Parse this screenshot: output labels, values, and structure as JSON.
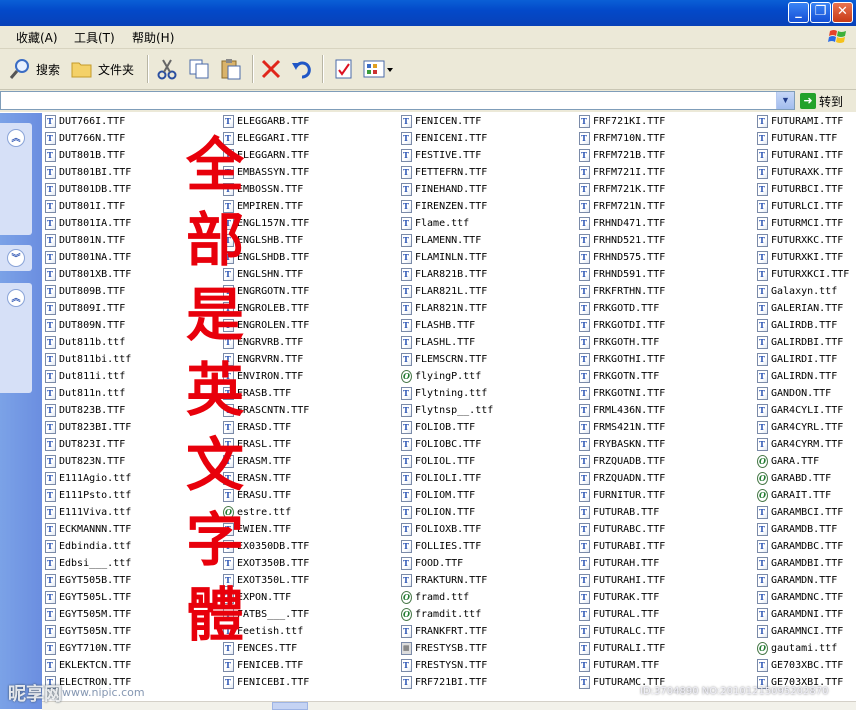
{
  "window": {
    "controls": {
      "minimize": "_",
      "restore": "❐",
      "close": "✕"
    }
  },
  "menubar": {
    "items": [
      "收藏(A)",
      "工具(T)",
      "帮助(H)"
    ]
  },
  "toolbar": {
    "search_label": "搜索",
    "folders_label": "文件夹"
  },
  "addressbar": {
    "value": "",
    "go_label": "转到"
  },
  "overlay_text": {
    "chars": [
      "全",
      "部",
      "是",
      "英",
      "文",
      "字",
      "體"
    ]
  },
  "files": {
    "columns": [
      [
        "DUT766I.TTF",
        "DUT766N.TTF",
        "DUT801B.TTF",
        "DUT801BI.TTF",
        "DUT801DB.TTF",
        "DUT801I.TTF",
        "DUT801IA.TTF",
        "DUT801N.TTF",
        "DUT801NA.TTF",
        "DUT801XB.TTF",
        "DUT809B.TTF",
        "DUT809I.TTF",
        "DUT809N.TTF",
        "Dut811b.ttf",
        "Dut811bi.ttf",
        "Dut811i.ttf",
        "Dut811n.ttf",
        "DUT823B.TTF",
        "DUT823BI.TTF",
        "DUT823I.TTF",
        "DUT823N.TTF",
        "E111Agio.ttf",
        "E111Psto.ttf",
        "E111Viva.ttf",
        "ECKMANNN.TTF",
        "Edbindia.ttf",
        "Edbsi___.ttf",
        "EGYT505B.TTF",
        "EGYT505L.TTF",
        "EGYT505M.TTF",
        "EGYT505N.TTF",
        "EGYT710N.TTF",
        "EKLEKTCN.TTF",
        "ELECTRON.TTF"
      ],
      [
        "ELEGGARB.TTF",
        "ELEGGARI.TTF",
        "ELEGGARN.TTF",
        "EMBASSYN.TTF",
        "EMBOSSN.TTF",
        "EMPIREN.TTF",
        "ENGL157N.TTF",
        "ENGLSHB.TTF",
        "ENGLSHDB.TTF",
        "ENGLSHN.TTF",
        "ENGRGOTN.TTF",
        "ENGROLEB.TTF",
        "ENGROLEN.TTF",
        "ENGRVRB.TTF",
        "ENGRVRN.TTF",
        "ENVIRON.TTF",
        "ERASB.TTF",
        "ERASCNTN.TTF",
        "ERASD.TTF",
        "ERASL.TTF",
        "ERASM.TTF",
        "ERASN.TTF",
        "ERASU.TTF",
        "estre.ttf",
        "EWIEN.TTF",
        "EX0350DB.TTF",
        "EXOT350B.TTF",
        "EXOT350L.TTF",
        "EXPON.TTF",
        "FATBS___.TTF",
        "Feetish.ttf",
        "FENCES.TTF",
        "FENICEB.TTF",
        "FENICEBI.TTF"
      ],
      [
        "FENICEN.TTF",
        "FENICENI.TTF",
        "FESTIVE.TTF",
        "FETTEFRN.TTF",
        "FINEHAND.TTF",
        "FIRENZEN.TTF",
        "Flame.ttf",
        "FLAMENN.TTF",
        "FLAMINLN.TTF",
        "FLAR821B.TTF",
        "FLAR821L.TTF",
        "FLAR821N.TTF",
        "FLASHB.TTF",
        "FLASHL.TTF",
        "FLEMSCRN.TTF",
        "flyingP.ttf",
        "Flytning.ttf",
        "Flytnsp__.ttf",
        "FOLIOB.TTF",
        "FOLIOBC.TTF",
        "FOLIOL.TTF",
        "FOLIOLI.TTF",
        "FOLIOM.TTF",
        "FOLION.TTF",
        "FOLIOXB.TTF",
        "FOLLIES.TTF",
        "FOOD.TTF",
        "FRAKTURN.TTF",
        "framd.ttf",
        "framdit.ttf",
        "FRANKFRT.TTF",
        "FRESTYSB.TTF",
        "FRESTYSN.TTF",
        "FRF721BI.TTF"
      ],
      [
        "FRF721KI.TTF",
        "FRFM710N.TTF",
        "FRFM721B.TTF",
        "FRFM721I.TTF",
        "FRFM721K.TTF",
        "FRFM721N.TTF",
        "FRHND471.TTF",
        "FRHND521.TTF",
        "FRHND575.TTF",
        "FRHND591.TTF",
        "FRKFRTHN.TTF",
        "FRKGOTD.TTF",
        "FRKGOTDI.TTF",
        "FRKGOTH.TTF",
        "FRKGOTHI.TTF",
        "FRKGOTN.TTF",
        "FRKGOTNI.TTF",
        "FRML436N.TTF",
        "FRMS421N.TTF",
        "FRYBASKN.TTF",
        "FRZQUADB.TTF",
        "FRZQUADN.TTF",
        "FURNITUR.TTF",
        "FUTURAB.TTF",
        "FUTURABC.TTF",
        "FUTURABI.TTF",
        "FUTURAH.TTF",
        "FUTURAHI.TTF",
        "FUTURAK.TTF",
        "FUTURAL.TTF",
        "FUTURALC.TTF",
        "FUTURALI.TTF",
        "FUTURAM.TTF",
        "FUTURAMC.TTF"
      ],
      [
        "FUTURAMI.TTF",
        "FUTURAN.TTF",
        "FUTURANI.TTF",
        "FUTURAXK.TTF",
        "FUTURBCI.TTF",
        "FUTURLCI.TTF",
        "FUTURMCI.TTF",
        "FUTURXKC.TTF",
        "FUTURXKI.TTF",
        "FUTURXKCI.TTF",
        "Galaxyn.ttf",
        "GALERIAN.TTF",
        "GALIRDB.TTF",
        "GALIRDBI.TTF",
        "GALIRDI.TTF",
        "GALIRDN.TTF",
        "GANDON.TTF",
        "GAR4CYLI.TTF",
        "GAR4CYRL.TTF",
        "GAR4CYRM.TTF",
        "GARA.TTF",
        "GARABD.TTF",
        "GARAIT.TTF",
        "GARAMBCI.TTF",
        "GARAMDB.TTF",
        "GARAMDBC.TTF",
        "GARAMDBI.TTF",
        "GARAMDN.TTF",
        "GARAMDNC.TTF",
        "GARAMDNI.TTF",
        "GARAMNCI.TTF",
        "gautami.ttf",
        "GE703XBC.TTF",
        "GE703XBI.TTF"
      ]
    ]
  },
  "watermark": {
    "left": "昵享网",
    "url": "www.nipic.com",
    "id": "ID:3704890 NO:20101215095202870"
  },
  "colors": {
    "accent_red": "#e8000b",
    "titlebar_blue": "#0a5fd6",
    "pane_blue": "#7ba2e7"
  }
}
